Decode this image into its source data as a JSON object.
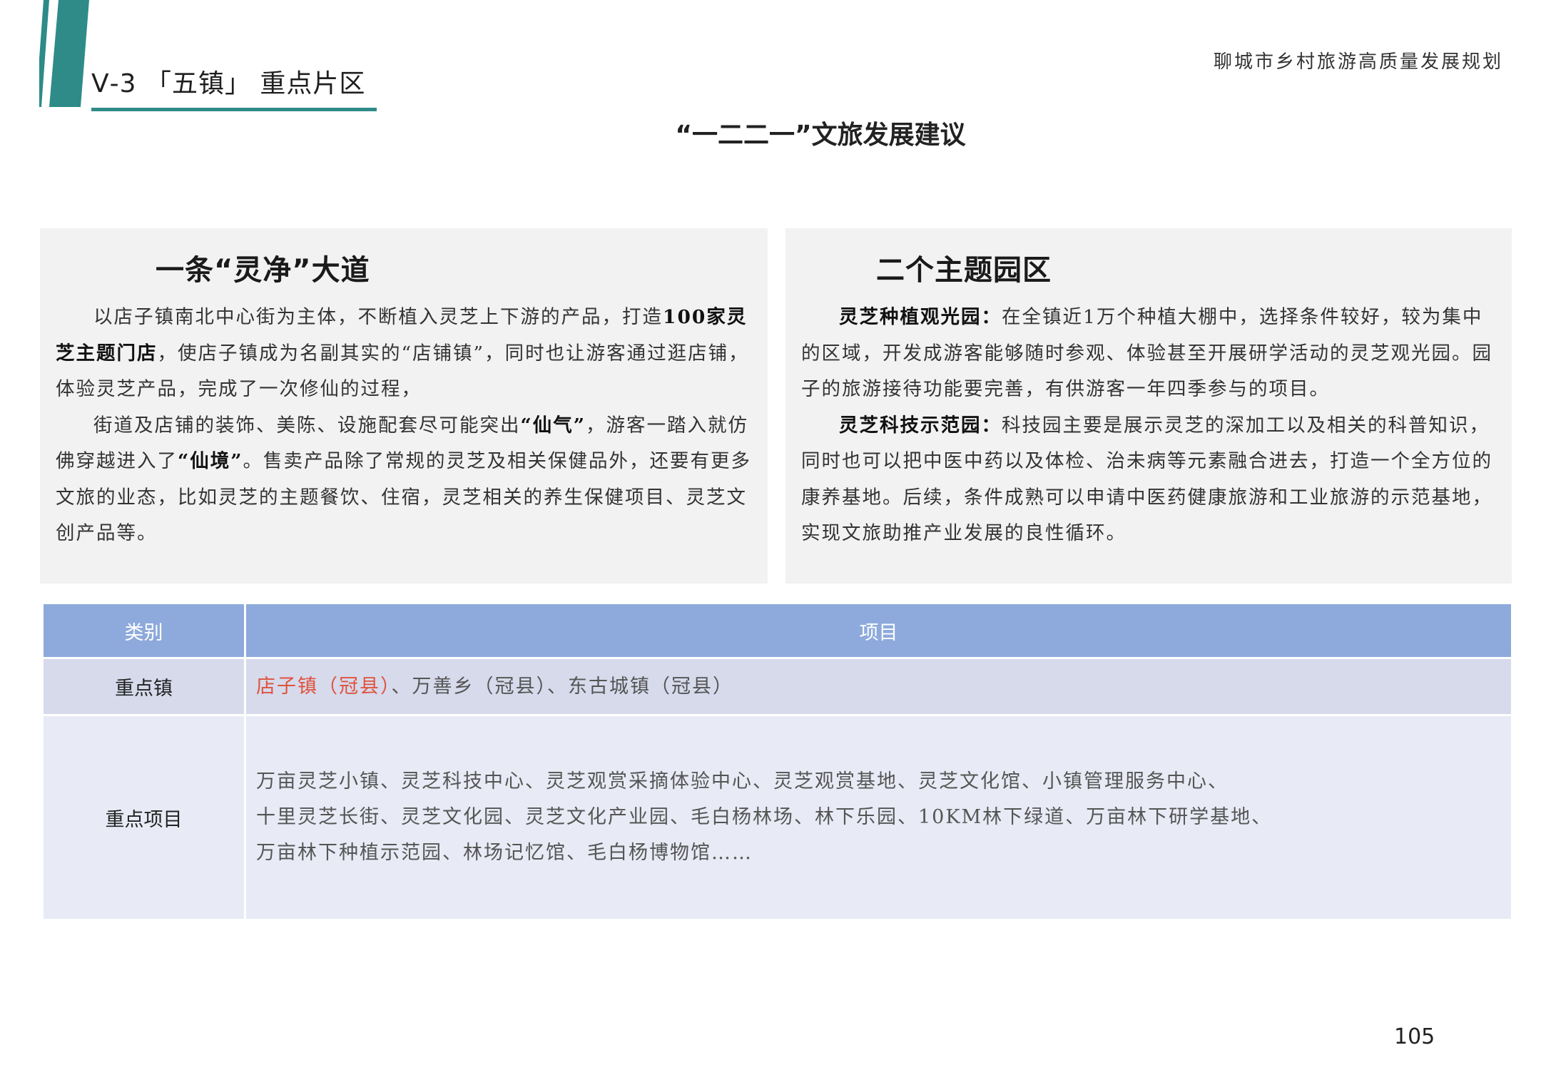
{
  "header": {
    "section_title": "Ⅴ-3 「五镇」 重点片区",
    "plan_title": "聊城市乡村旅游高质量发展规划",
    "accent_color": "#2e8b88"
  },
  "subtitle": "“一二二一”文旅发展建议",
  "left_panel": {
    "heading": "一条“灵净”大道",
    "paragraphs": [
      {
        "parts": [
          {
            "text": "以店子镇南北中心街为主体，不断植入灵芝上下游的产品，打造",
            "bold": false
          },
          {
            "text": "100家灵芝主题门店",
            "bold": true
          },
          {
            "text": "，使店子镇成为名副其实的“店铺镇”，同时也让游客通过逛店铺，体验灵芝产品，完成了一次修仙的过程，",
            "bold": false
          }
        ]
      },
      {
        "parts": [
          {
            "text": "街道及店铺的装饰、美陈、设施配套尽可能突出",
            "bold": false
          },
          {
            "text": "“仙气”",
            "bold": true
          },
          {
            "text": "，游客一踏入就仿佛穿越进入了",
            "bold": false
          },
          {
            "text": "“仙境”",
            "bold": true
          },
          {
            "text": "。售卖产品除了常规的灵芝及相关保健品外，还要有更多文旅的业态，比如灵芝的主题餐饮、住宿，灵芝相关的养生保健项目、灵芝文创产品等。",
            "bold": false
          }
        ]
      }
    ]
  },
  "right_panel": {
    "heading": "二个主题园区",
    "paragraphs": [
      {
        "parts": [
          {
            "text": "灵芝种植观光园：",
            "bold": true
          },
          {
            "text": "在全镇近1万个种植大棚中，选择条件较好，较为集中的区域，开发成游客能够随时参观、体验甚至开展研学活动的灵芝观光园。园子的旅游接待功能要完善，有供游客一年四季参与的项目。",
            "bold": false
          }
        ]
      },
      {
        "parts": [
          {
            "text": "灵芝科技示范园：",
            "bold": true
          },
          {
            "text": "科技园主要是展示灵芝的深加工以及相关的科普知识，同时也可以把中医中药以及体检、治未病等元素融合进去，打造一个全方位的康养基地。后续，条件成熟可以申请中医药健康旅游和工业旅游的示范基地，实现文旅助推产业发展的良性循环。",
            "bold": false
          }
        ]
      }
    ]
  },
  "table": {
    "headers": [
      "类别",
      "项目"
    ],
    "header_color": "#8eaadc",
    "rows": {
      "towns": {
        "category": "重点镇",
        "highlight": "店子镇（冠县）",
        "highlight_color": "#e0523d",
        "rest": "、万善乡（冠县）、东古城镇（冠县）"
      },
      "projects": {
        "category": "重点项目",
        "lines": [
          "万亩灵芝小镇、灵芝科技中心、灵芝观赏采摘体验中心、灵芝观赏基地、灵芝文化馆、小镇管理服务中心、",
          "十里灵芝长街、灵芝文化园、灵芝文化产业园、毛白杨林场、林下乐园、10KM林下绿道、万亩林下研学基地、",
          "万亩林下种植示范园、林场记忆馆、毛白杨博物馆……"
        ]
      }
    }
  },
  "page_number": "105"
}
